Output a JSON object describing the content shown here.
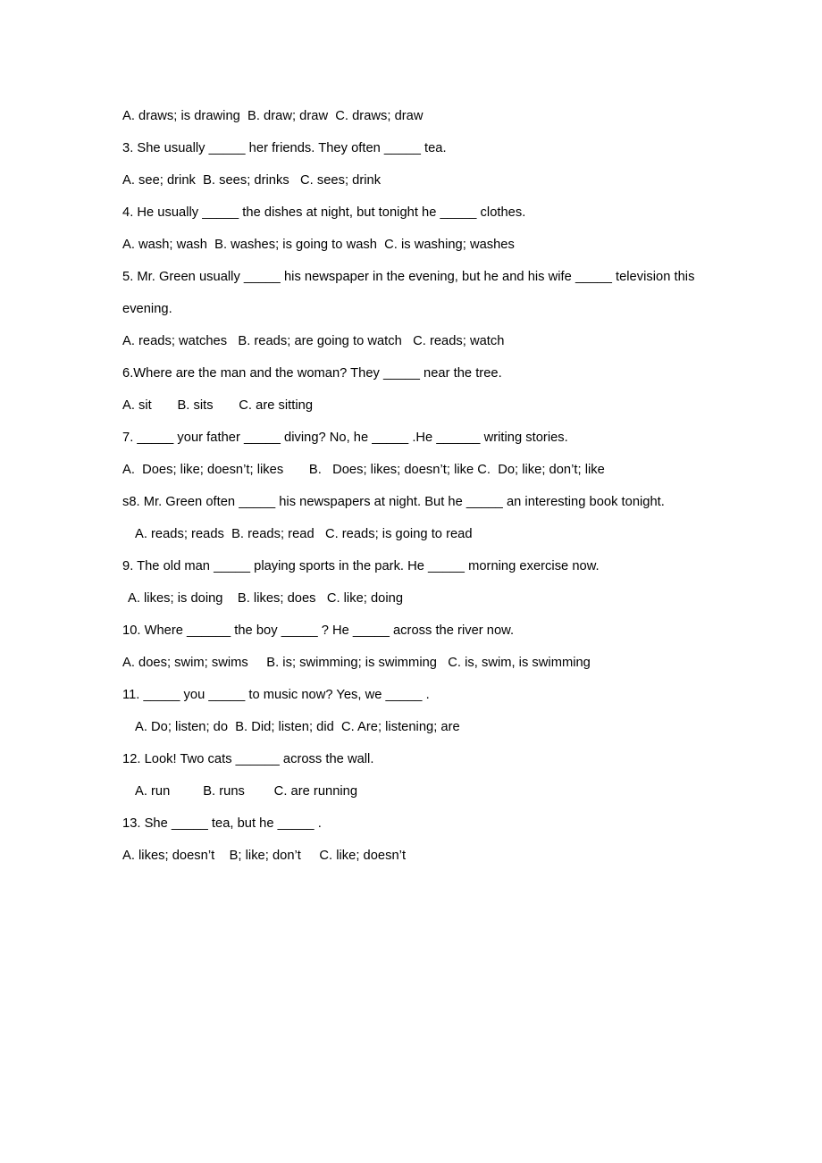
{
  "document": {
    "type": "grammar-exercise-worksheet",
    "lines": [
      {
        "id": "q2-options",
        "text": "A. draws; is drawing  B. draw; draw  C. draws; draw",
        "indent": "none"
      },
      {
        "id": "q3-stem",
        "text": "3. She usually _____ her friends. They often _____ tea.",
        "indent": "none"
      },
      {
        "id": "q3-options",
        "text": "A. see; drink  B. sees; drinks   C. sees; drink",
        "indent": "none"
      },
      {
        "id": "q4-stem",
        "text": "4. He usually _____ the dishes at night, but tonight he _____ clothes.",
        "indent": "none"
      },
      {
        "id": "q4-options",
        "text": "A. wash; wash  B. washes; is going to wash  C. is washing; washes",
        "indent": "none"
      },
      {
        "id": "q5-stem",
        "text": "5. Mr. Green usually _____ his newspaper in the evening, but he and his wife _____ television this evening.",
        "indent": "none"
      },
      {
        "id": "q5-options",
        "text": "A. reads; watches   B. reads; are going to watch   C. reads; watch",
        "indent": "none"
      },
      {
        "id": "q6-stem",
        "text": "6.Where are the man and the woman? They _____ near the tree.",
        "indent": "none"
      },
      {
        "id": "q6-options",
        "text": "A. sit       B. sits       C. are sitting",
        "indent": "none"
      },
      {
        "id": "q7-stem",
        "text": "7. _____ your father _____ diving? No, he _____ .He ______ writing stories.",
        "indent": "none"
      },
      {
        "id": "q7-options",
        "text": "A.  Does; like; doesn’t; likes       B.   Does; likes; doesn’t; like C.  Do; like; don’t; like",
        "indent": "none"
      },
      {
        "id": "q8-stem",
        "text": "s8. Mr. Green often _____ his newspapers at night. But he _____ an interesting book tonight.",
        "indent": "none"
      },
      {
        "id": "q8-options",
        "text": "A. reads; reads  B. reads; read   C. reads; is going to read",
        "indent": "large"
      },
      {
        "id": "q9-stem",
        "text": "9. The old man _____ playing sports in the park. He _____ morning exercise now.",
        "indent": "none"
      },
      {
        "id": "q9-options",
        "text": "A. likes; is doing    B. likes; does   C. like; doing",
        "indent": "small"
      },
      {
        "id": "q10-stem",
        "text": "10. Where ______ the boy _____ ? He _____ across the river now.",
        "indent": "none"
      },
      {
        "id": "q10-options",
        "text": "A. does; swim; swims     B. is; swimming; is swimming   C. is, swim, is swimming",
        "indent": "none"
      },
      {
        "id": "q11-stem",
        "text": "11. _____ you _____ to music now? Yes, we _____ .",
        "indent": "none"
      },
      {
        "id": "q11-options",
        "text": "A. Do; listen; do  B. Did; listen; did  C. Are; listening; are",
        "indent": "large"
      },
      {
        "id": "q12-stem",
        "text": "12. Look! Two cats ______ across the wall.",
        "indent": "none"
      },
      {
        "id": "q12-options",
        "text": "A. run         B. runs        C. are running",
        "indent": "large"
      },
      {
        "id": "q13-stem",
        "text": "13. She _____ tea, but he _____ .",
        "indent": "none"
      },
      {
        "id": "q13-options",
        "text": "A. likes; doesn’t    B; like; don’t     C. like; doesn’t",
        "indent": "none"
      }
    ]
  }
}
